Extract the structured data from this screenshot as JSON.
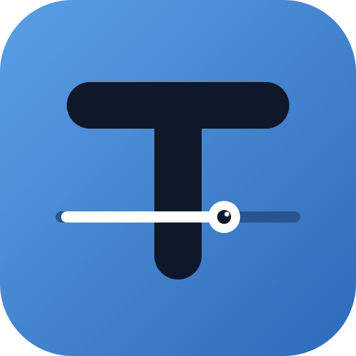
{
  "icon": {
    "name": "t-letter-slider-app-icon",
    "colors": {
      "background_start": "#5A9FE6",
      "background_end": "#2E6AB8",
      "letter": "#0F172A",
      "slider_fill": "#FFFFFF",
      "slider_track": "#28558F",
      "knob": "#FFFFFF",
      "knob_dot": "#0F172A"
    },
    "slider": {
      "value_fraction": 0.69
    }
  }
}
